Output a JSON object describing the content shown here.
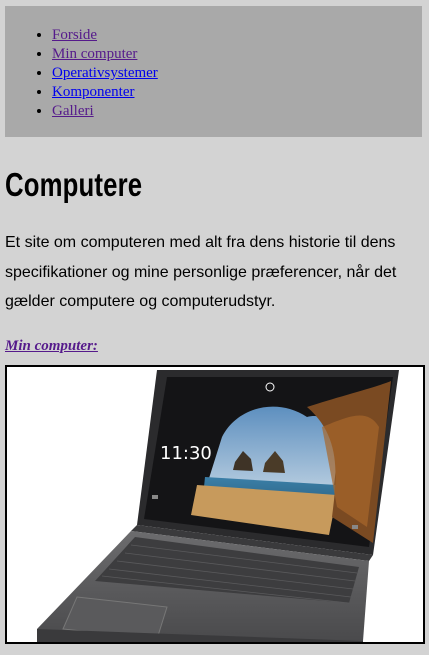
{
  "nav": {
    "items": [
      {
        "label": "Forside",
        "state": "visited"
      },
      {
        "label": "Min computer",
        "state": "visited"
      },
      {
        "label": "Operativsystemer",
        "state": "link"
      },
      {
        "label": "Komponenter",
        "state": "link"
      },
      {
        "label": "Galleri",
        "state": "visited"
      }
    ]
  },
  "main": {
    "title": "Computere",
    "intro": "Et site om computeren med alt fra dens historie til dens specifikationer og mine personlige præferencer, når det gælder computere og computerudstyr.",
    "computer_link": "Min computer:",
    "screen_clock": "11:30"
  },
  "colors": {
    "page_bg": "#d3d3d3",
    "nav_bg": "#a9a9a9",
    "visited_link": "#551a8b",
    "link": "#0000ee"
  }
}
